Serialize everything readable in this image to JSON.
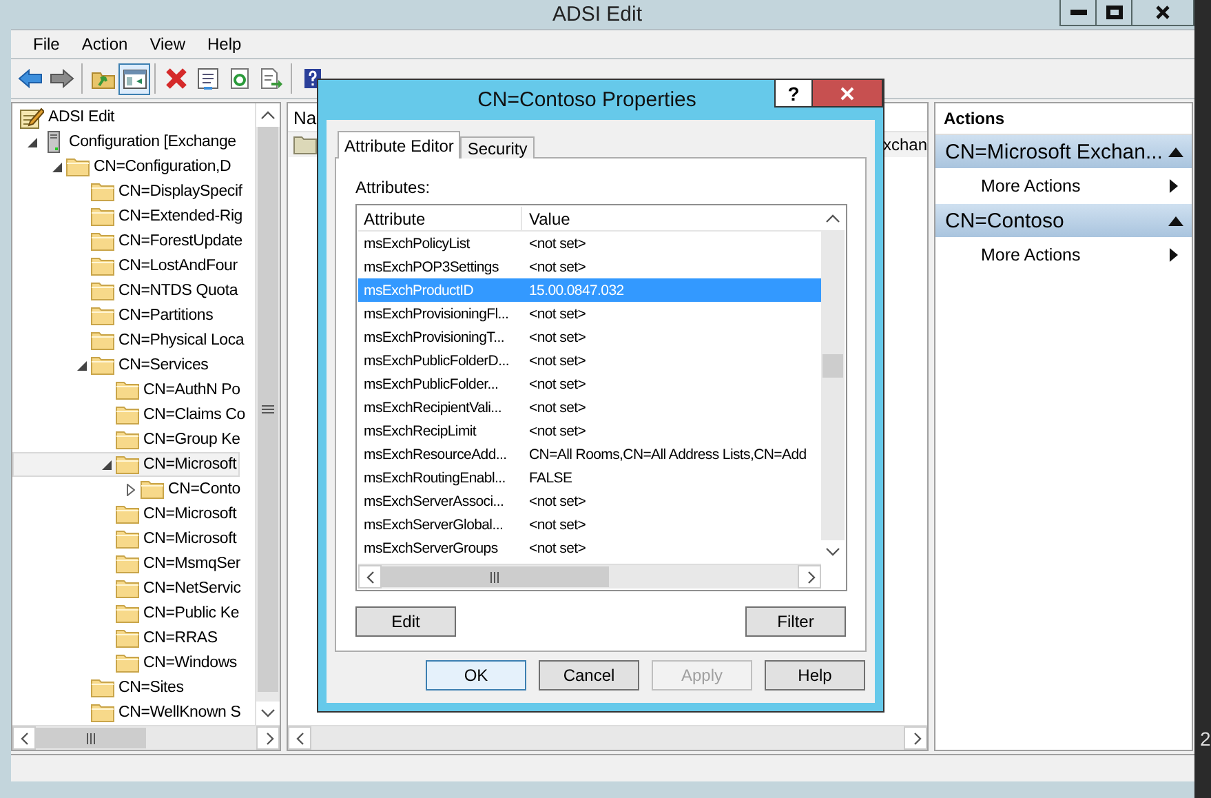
{
  "window": {
    "title": "ADSI Edit"
  },
  "menu": [
    "File",
    "Action",
    "View",
    "Help"
  ],
  "toolbar": [
    {
      "kind": "back",
      "selected": false
    },
    {
      "kind": "forward",
      "selected": false
    },
    {
      "kind": "sep"
    },
    {
      "kind": "up",
      "selected": false
    },
    {
      "kind": "tree",
      "selected": true
    },
    {
      "kind": "sep"
    },
    {
      "kind": "delete",
      "selected": false
    },
    {
      "kind": "properties",
      "selected": false
    },
    {
      "kind": "refresh",
      "selected": false
    },
    {
      "kind": "export",
      "selected": false
    },
    {
      "kind": "sep"
    },
    {
      "kind": "help",
      "selected": false
    }
  ],
  "tree": {
    "items": [
      {
        "kind": "root",
        "text": "ADSI Edit",
        "selected": false,
        "children": [
          {
            "kind": "server",
            "text": "Configuration [Exchange",
            "selected": false,
            "expanded": true,
            "children": [
              {
                "kind": "folder",
                "text": "CN=Configuration,D",
                "selected": false,
                "expanded": true,
                "children": [
                  {
                    "kind": "folder",
                    "text": "CN=DisplaySpecif",
                    "selected": false
                  },
                  {
                    "kind": "folder",
                    "text": "CN=Extended-Rig",
                    "selected": false
                  },
                  {
                    "kind": "folder",
                    "text": "CN=ForestUpdate",
                    "selected": false
                  },
                  {
                    "kind": "folder",
                    "text": "CN=LostAndFour",
                    "selected": false
                  },
                  {
                    "kind": "folder",
                    "text": "CN=NTDS Quota",
                    "selected": false
                  },
                  {
                    "kind": "folder",
                    "text": "CN=Partitions",
                    "selected": false
                  },
                  {
                    "kind": "folder",
                    "text": "CN=Physical Loca",
                    "selected": false
                  },
                  {
                    "kind": "folder",
                    "text": "CN=Services",
                    "selected": false,
                    "expanded": true,
                    "children": [
                      {
                        "kind": "folder",
                        "text": "CN=AuthN Po",
                        "selected": false
                      },
                      {
                        "kind": "folder",
                        "text": "CN=Claims Co",
                        "selected": false
                      },
                      {
                        "kind": "folder",
                        "text": "CN=Group Ke",
                        "selected": false
                      },
                      {
                        "kind": "folder",
                        "text": "CN=Microsoft",
                        "selected": true,
                        "expanded": true,
                        "children": [
                          {
                            "kind": "folder",
                            "text": "CN=Conto",
                            "selected": false,
                            "expanded": false
                          }
                        ]
                      },
                      {
                        "kind": "folder",
                        "text": "CN=Microsoft",
                        "selected": false
                      },
                      {
                        "kind": "folder",
                        "text": "CN=Microsoft",
                        "selected": false
                      },
                      {
                        "kind": "folder",
                        "text": "CN=MsmqSer",
                        "selected": false
                      },
                      {
                        "kind": "folder",
                        "text": "CN=NetServic",
                        "selected": false
                      },
                      {
                        "kind": "folder",
                        "text": "CN=Public Ke",
                        "selected": false
                      },
                      {
                        "kind": "folder",
                        "text": "CN=RRAS",
                        "selected": false
                      },
                      {
                        "kind": "folder",
                        "text": "CN=Windows",
                        "selected": false
                      }
                    ]
                  },
                  {
                    "kind": "folder",
                    "text": "CN=Sites",
                    "selected": false
                  },
                  {
                    "kind": "folder",
                    "text": "CN=WellKnown S",
                    "selected": false
                  }
                ]
              }
            ]
          }
        ]
      }
    ]
  },
  "list": {
    "columns": [
      "Na"
    ],
    "rows": [
      {
        "kind": "folder",
        "text": "xchan"
      }
    ]
  },
  "actions": {
    "title": "Actions",
    "sections": [
      {
        "title": "CN=Microsoft Exchan...",
        "expanded": true,
        "items": [
          "More Actions"
        ]
      },
      {
        "title": "CN=Contoso",
        "expanded": true,
        "items": [
          "More Actions"
        ]
      }
    ]
  },
  "dialog": {
    "title": "CN=Contoso Properties",
    "help_button": "?",
    "tabs": [
      {
        "label": "Attribute Editor",
        "selected": true
      },
      {
        "label": "Security",
        "selected": false
      }
    ],
    "attributes_label": "Attributes:",
    "columns": [
      "Attribute",
      "Value"
    ],
    "rows": [
      {
        "attribute": "msExchPolicyList",
        "value": "<not set>",
        "selected": false
      },
      {
        "attribute": "msExchPOP3Settings",
        "value": "<not set>",
        "selected": false
      },
      {
        "attribute": "msExchProductID",
        "value": "15.00.0847.032",
        "selected": true
      },
      {
        "attribute": "msExchProvisioningFl...",
        "value": "<not set>",
        "selected": false
      },
      {
        "attribute": "msExchProvisioningT...",
        "value": "<not set>",
        "selected": false
      },
      {
        "attribute": "msExchPublicFolderD...",
        "value": "<not set>",
        "selected": false
      },
      {
        "attribute": "msExchPublicFolder...",
        "value": "<not set>",
        "selected": false
      },
      {
        "attribute": "msExchRecipientVali...",
        "value": "<not set>",
        "selected": false
      },
      {
        "attribute": "msExchRecipLimit",
        "value": "<not set>",
        "selected": false
      },
      {
        "attribute": "msExchResourceAdd...",
        "value": "CN=All Rooms,CN=All Address Lists,CN=Add",
        "selected": false
      },
      {
        "attribute": "msExchRoutingEnabl...",
        "value": "FALSE",
        "selected": false
      },
      {
        "attribute": "msExchServerAssoci...",
        "value": "<not set>",
        "selected": false
      },
      {
        "attribute": "msExchServerGlobal...",
        "value": "<not set>",
        "selected": false
      },
      {
        "attribute": "msExchServerGroups",
        "value": "<not set>",
        "selected": false
      }
    ],
    "list_buttons": [
      "Edit",
      "Filter"
    ],
    "buttons": [
      {
        "label": "OK",
        "default": true,
        "disabled": false
      },
      {
        "label": "Cancel",
        "default": false,
        "disabled": false
      },
      {
        "label": "Apply",
        "default": false,
        "disabled": true
      },
      {
        "label": "Help",
        "default": false,
        "disabled": false
      }
    ]
  },
  "edge_text": "2"
}
